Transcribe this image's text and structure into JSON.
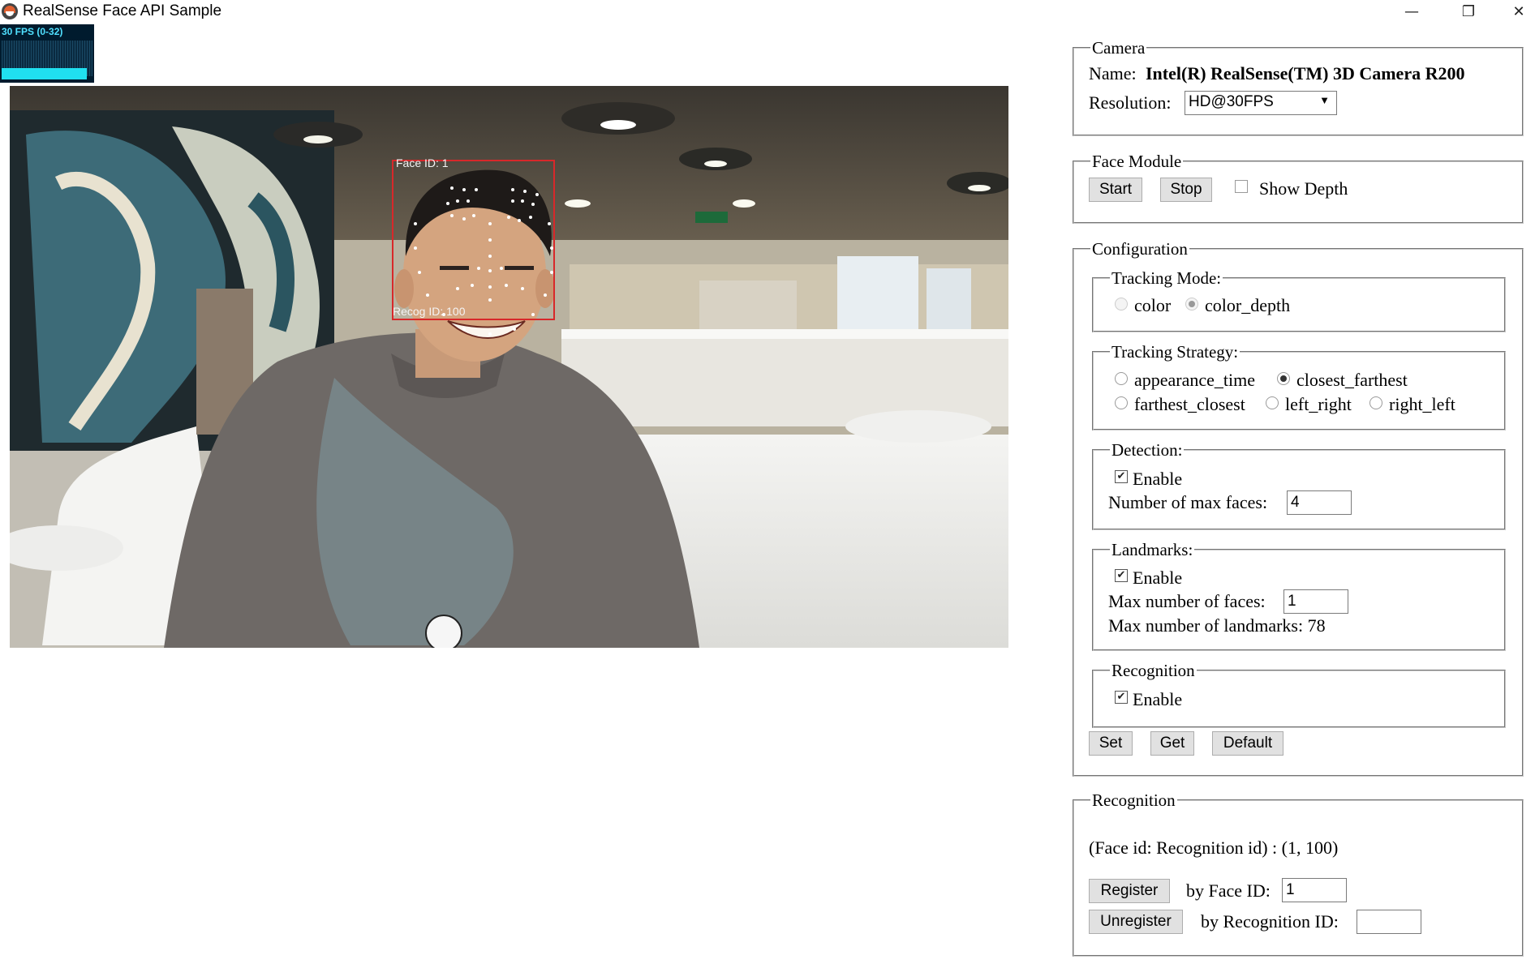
{
  "window": {
    "title": "RealSense Face API Sample"
  },
  "fps": {
    "label": "30 FPS (0-32)",
    "fraction": 0.94
  },
  "overlay": {
    "face_id": "Face ID: 1",
    "recog_id": "Recog ID: 100"
  },
  "camera": {
    "legend": "Camera",
    "name_label": "Name:",
    "name_value": "Intel(R) RealSense(TM) 3D Camera R200",
    "resolution_label": "Resolution:",
    "resolution_value": "HD@30FPS"
  },
  "face_module": {
    "legend": "Face Module",
    "start": "Start",
    "stop": "Stop",
    "show_depth_label": "Show Depth",
    "show_depth_checked": false
  },
  "configuration": {
    "legend": "Configuration",
    "tracking_mode": {
      "legend": "Tracking Mode:",
      "options": [
        "color",
        "color_depth"
      ],
      "selected": "color_depth"
    },
    "tracking_strategy": {
      "legend": "Tracking Strategy:",
      "options": [
        "appearance_time",
        "closest_farthest",
        "farthest_closest",
        "left_right",
        "right_left"
      ],
      "selected": "closest_farthest"
    },
    "detection": {
      "legend": "Detection:",
      "enable_label": "Enable",
      "enabled": true,
      "max_faces_label": "Number of max faces:",
      "max_faces_value": "4"
    },
    "landmarks": {
      "legend": "Landmarks:",
      "enable_label": "Enable",
      "enabled": true,
      "max_faces_label": "Max number of faces:",
      "max_faces_value": "1",
      "max_landmarks_text": "Max number of landmarks: 78"
    },
    "recognition": {
      "legend": "Recognition",
      "enable_label": "Enable",
      "enabled": true
    },
    "set": "Set",
    "get": "Get",
    "default": "Default"
  },
  "recognition": {
    "legend": "Recognition",
    "status": "(Face id: Recognition id) : (1, 100)",
    "register": "Register",
    "by_face_label": "by Face ID:",
    "by_face_value": "1",
    "unregister": "Unregister",
    "by_recog_label": "by Recognition ID:",
    "by_recog_value": ""
  }
}
